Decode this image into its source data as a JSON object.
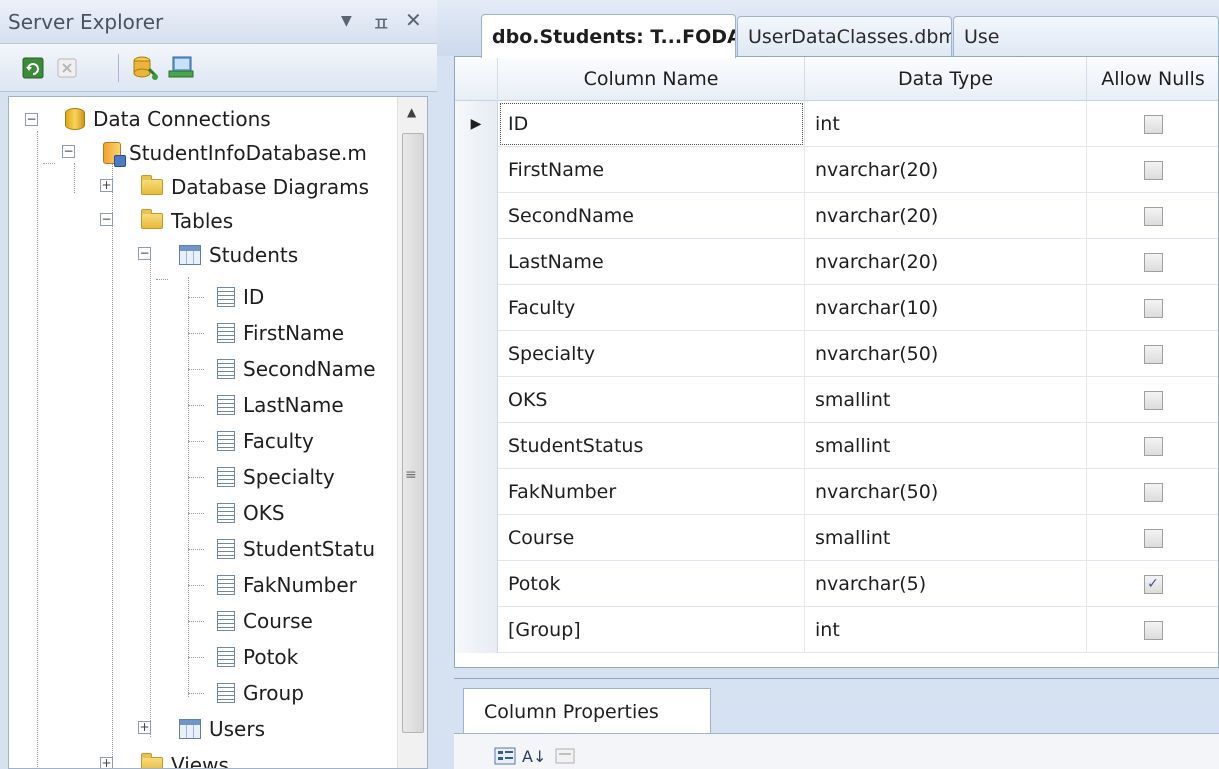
{
  "explorer": {
    "title": "Server Explorer",
    "buttons": {
      "dropdown": "▼",
      "pin": "ㅍ",
      "close": "✕"
    },
    "toolbar": [
      "refresh-icon",
      "stop-icon",
      "connect-database-icon",
      "connect-server-icon"
    ],
    "tree": {
      "data_connections": "Data Connections",
      "database": "StudentInfoDatabase.m",
      "database_diagrams": "Database Diagrams",
      "tables": "Tables",
      "students": "Students",
      "columns": [
        "ID",
        "FirstName",
        "SecondName",
        "LastName",
        "Faculty",
        "Specialty",
        "OKS",
        "StudentStatu",
        "FakNumber",
        "Course",
        "Potok",
        "Group"
      ],
      "users": "Users",
      "views": "Views"
    }
  },
  "tabs": [
    {
      "label": "dbo.Students: T...FODATABASE.MDF)*",
      "active": true
    },
    {
      "label": "UserDataClasses.dbml",
      "active": false
    },
    {
      "label": "Use",
      "active": false
    }
  ],
  "grid": {
    "headers": {
      "name": "Column Name",
      "type": "Data Type",
      "nulls": "Allow Nulls"
    },
    "row_indicator": "▶",
    "rows": [
      {
        "name": "ID",
        "type": "int",
        "allow_nulls": false
      },
      {
        "name": "FirstName",
        "type": "nvarchar(20)",
        "allow_nulls": false
      },
      {
        "name": "SecondName",
        "type": "nvarchar(20)",
        "allow_nulls": false
      },
      {
        "name": "LastName",
        "type": "nvarchar(20)",
        "allow_nulls": false
      },
      {
        "name": "Faculty",
        "type": "nvarchar(10)",
        "allow_nulls": false
      },
      {
        "name": "Specialty",
        "type": "nvarchar(50)",
        "allow_nulls": false
      },
      {
        "name": "OKS",
        "type": "smallint",
        "allow_nulls": false
      },
      {
        "name": "StudentStatus",
        "type": "smallint",
        "allow_nulls": false
      },
      {
        "name": "FakNumber",
        "type": "nvarchar(50)",
        "allow_nulls": false
      },
      {
        "name": "Course",
        "type": "smallint",
        "allow_nulls": false
      },
      {
        "name": "Potok",
        "type": "nvarchar(5)",
        "allow_nulls": true
      },
      {
        "name": "[Group]",
        "type": "int",
        "allow_nulls": false
      }
    ]
  },
  "column_properties": {
    "tab_label": "Column Properties",
    "toolbar": [
      "categorized-icon",
      "alphabetical-icon",
      "property-pages-icon"
    ],
    "alpha_label": "A↓"
  },
  "colors": {
    "accent": "#3a5a92",
    "panel": "#d7e2f1",
    "tree_background": "#ffffff"
  }
}
